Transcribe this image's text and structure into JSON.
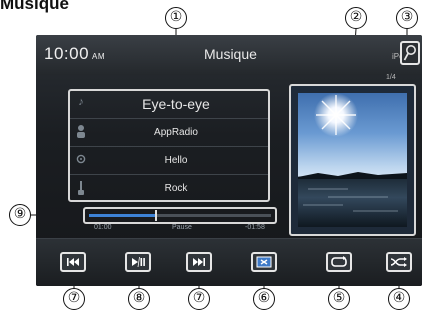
{
  "figure": {
    "heading": "Musique"
  },
  "callouts": [
    "①",
    "②",
    "③",
    "④",
    "⑤",
    "⑥",
    "⑦",
    "⑧",
    "⑨"
  ],
  "status_bar": {
    "time": "10:00",
    "ampm": "AM",
    "title": "Musique",
    "device": "iPod"
  },
  "track_counter": "1/4",
  "track_info": [
    {
      "icon": "music-note-icon",
      "text": "Eye-to-eye"
    },
    {
      "icon": "artist-icon",
      "text": "AppRadio"
    },
    {
      "icon": "album-icon",
      "text": "Hello"
    },
    {
      "icon": "genre-icon",
      "text": "Rock"
    }
  ],
  "playback": {
    "elapsed": "01:00",
    "status": "Pause",
    "remaining": "-01:58",
    "progress": 0.37
  },
  "controls": [
    "previous-track",
    "play-pause",
    "next-track",
    "display-toggle",
    "repeat",
    "shuffle"
  ]
}
